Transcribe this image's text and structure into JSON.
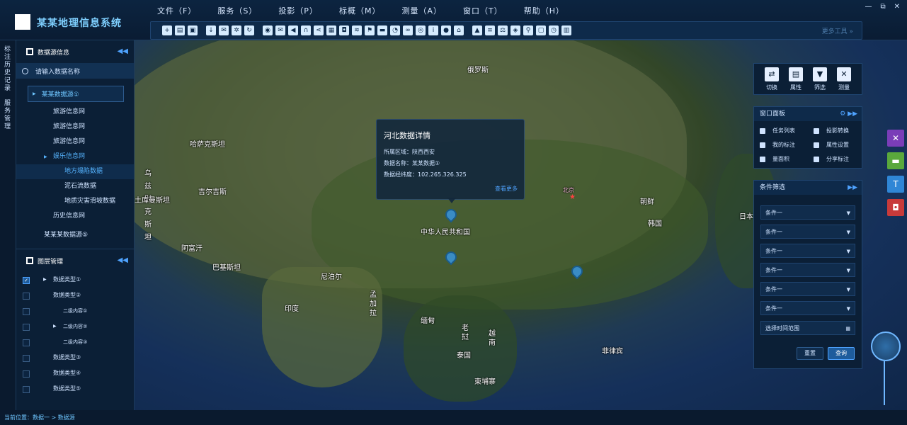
{
  "app": {
    "title": "某某地理信息系统"
  },
  "menu": [
    "文件（F）",
    "服务（S）",
    "投影（P）",
    "标概（M）",
    "测量（A）",
    "窗口（T）",
    "帮助（H）"
  ],
  "window_controls": [
    "—",
    "⧉",
    "✕"
  ],
  "toolbar": {
    "more_label": "更多工具 »"
  },
  "left_rail": {
    "annotation_history": "标注历史记录",
    "service_manage": "服务管理"
  },
  "data_source": {
    "title": "数据源信息",
    "search_placeholder": "请输入数据名称",
    "selected_source": "某某数据源①",
    "items": [
      "旅游信息网",
      "旅游信息网",
      "旅游信息网",
      "娱乐信息网",
      "地方塌陷数据",
      "泥石流数据",
      "地质灾害滑坡数据",
      "历史信息网",
      "某某某数据源⑤"
    ]
  },
  "layers": {
    "title": "图层管理",
    "items": [
      "数据类型①",
      "数据类型②",
      "二级内容①",
      "二级内容②",
      "二级内容③",
      "数据类型③",
      "数据类型④",
      "数据类型⑤"
    ]
  },
  "map_labels": [
    "俄罗斯",
    "哈萨克斯坦",
    "中华人民共和国",
    "北京",
    "朝鲜",
    "韩国",
    "日本",
    "尼泊尔",
    "印度",
    "孟加拉",
    "缅甸",
    "老挝",
    "越南",
    "泰国",
    "柬埔寨",
    "菲律宾",
    "巴基斯坦",
    "阿富汗",
    "乌兹别克斯坦",
    "吉尔吉斯",
    "土库曼斯坦"
  ],
  "popup": {
    "title": "河北数据详情",
    "region": "所属区域：陕西西安",
    "name": "数据名称：某某数据①",
    "coords": "数据经纬度：102.265.326.325",
    "more": "查看更多"
  },
  "right_tools": [
    "切换",
    "属性",
    "筛选",
    "测量"
  ],
  "window_panel": {
    "title": "窗口面板",
    "items": [
      "任务列表",
      "投影转换",
      "我的标注",
      "属性设置",
      "量面积",
      "分享标注"
    ]
  },
  "filter": {
    "title": "条件筛选",
    "conditions": [
      "条件一",
      "条件一",
      "条件一",
      "条件一",
      "条件一",
      "条件一"
    ],
    "time_range": "选择时间范围",
    "reset": "重置",
    "query": "查询"
  },
  "status": {
    "text": "当前位置：数据一 > 数据源"
  },
  "colors": {
    "accent": "#4fa3ff",
    "panel": "#0b1f36",
    "primary_button": "#1e5c9c"
  }
}
